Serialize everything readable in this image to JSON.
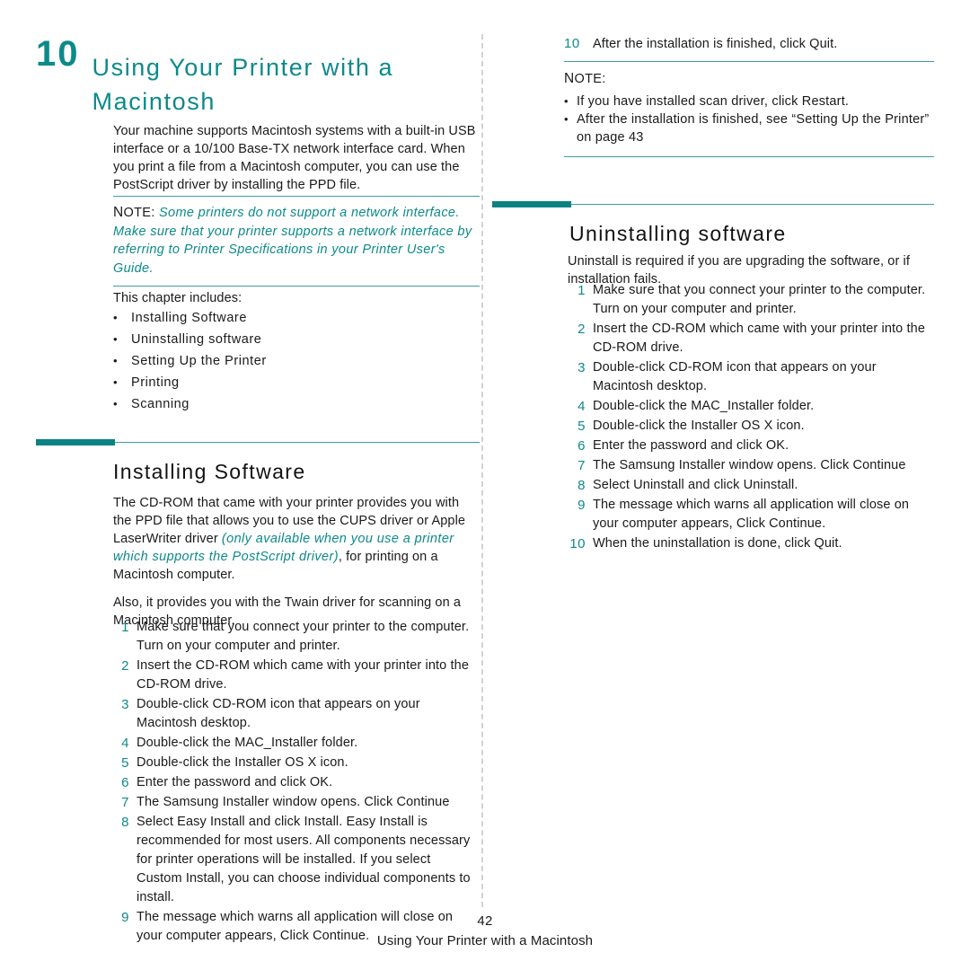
{
  "chapter": {
    "number": "10",
    "title": "Using Your Printer with a Macintosh",
    "intro": "Your machine supports Macintosh systems with a built-in USB interface or a 10/100 Base-TX network interface card. When you print a file from a Macintosh computer, you can use the PostScript driver by installing the PPD file."
  },
  "note_left": {
    "label_first": "N",
    "label_rest": "OTE",
    "label_colon": ":",
    "body": "Some printers do not support a network interface. Make sure that your printer supports a network interface by referring to Printer Specifications in your Printer User's Guide."
  },
  "chapter_includes": {
    "intro": "This chapter includes:",
    "items": [
      "Installing Software",
      "Uninstalling software",
      "Setting Up the Printer",
      "Printing",
      "Scanning"
    ],
    "bullet_glyph": "•"
  },
  "installing": {
    "heading": "Installing Software",
    "para1_a": "The CD-ROM that came with your printer provides you with the PPD file that allows you to use the CUPS driver or Apple LaserWriter driver ",
    "para1_em": "(only available when you use a printer which supports the PostScript driver)",
    "para1_b": ", for printing on a Macintosh computer.",
    "para2": "Also, it provides you with the Twain driver for scanning on a Macintosh computer.",
    "steps": [
      {
        "num": "1",
        "text": "Make sure that you connect your printer to the computer. Turn on your computer and printer."
      },
      {
        "num": "2",
        "text": "Insert the CD-ROM which came with your printer into the CD-ROM drive."
      },
      {
        "num": "3",
        "text": "Double-click CD-ROM icon that appears on your Macintosh desktop."
      },
      {
        "num": "4",
        "text": "Double-click the MAC_Installer folder."
      },
      {
        "num": "5",
        "text": "Double-click the Installer OS X icon."
      },
      {
        "num": "6",
        "text": "Enter the password and click OK."
      },
      {
        "num": "7",
        "text": "The Samsung Installer window opens. Click Continue"
      },
      {
        "num": "8",
        "text": "Select Easy Install and click Install. Easy Install is recommended for most users. All components necessary for printer operations will be installed. If you select Custom Install, you can choose individual components to install."
      },
      {
        "num": "9",
        "text": "The message which warns all application will close on your computer appears, Click Continue."
      }
    ]
  },
  "right_top": {
    "step10_num": "10",
    "step10_text": "After the installation is finished, click Quit.",
    "note_label_first": "N",
    "note_label_rest": "OTE",
    "note_label_colon": ":",
    "note_bullets": [
      "If you have installed scan driver, click Restart.",
      "After the installation is finished, see “Setting Up the Printer” on page 43"
    ],
    "bullet_glyph": "•"
  },
  "uninstalling": {
    "heading": "Uninstalling software",
    "intro": "Uninstall is required if you are upgrading the software, or if installation fails.",
    "steps": [
      {
        "num": "1",
        "text": "Make sure that you connect your printer to the computer. Turn on your computer and printer."
      },
      {
        "num": "2",
        "text": "Insert the CD-ROM which came with your printer into the CD-ROM drive."
      },
      {
        "num": "3",
        "text": "Double-click CD-ROM icon that appears on your Macintosh desktop."
      },
      {
        "num": "4",
        "text": "Double-click the MAC_Installer folder."
      },
      {
        "num": "5",
        "text": "Double-click the Installer OS X icon."
      },
      {
        "num": "6",
        "text": "Enter the password and click OK."
      },
      {
        "num": "7",
        "text": "The Samsung Installer window opens. Click Continue"
      },
      {
        "num": "8",
        "text": "Select Uninstall and click Uninstall."
      },
      {
        "num": "9",
        "text": "The message which warns all application will close on your computer appears, Click Continue."
      },
      {
        "num": "10",
        "text": "When the uninstallation is done, click Quit."
      }
    ]
  },
  "footer": {
    "page_number": "42",
    "title": "Using Your Printer with a Macintosh"
  },
  "colors": {
    "teal_accent": "#0c8a8a",
    "teal_bar": "#0a8282",
    "teal_rule": "#3f9f9f",
    "divider_gray": "#d2d2d2",
    "text_black": "#1a1a1a"
  }
}
